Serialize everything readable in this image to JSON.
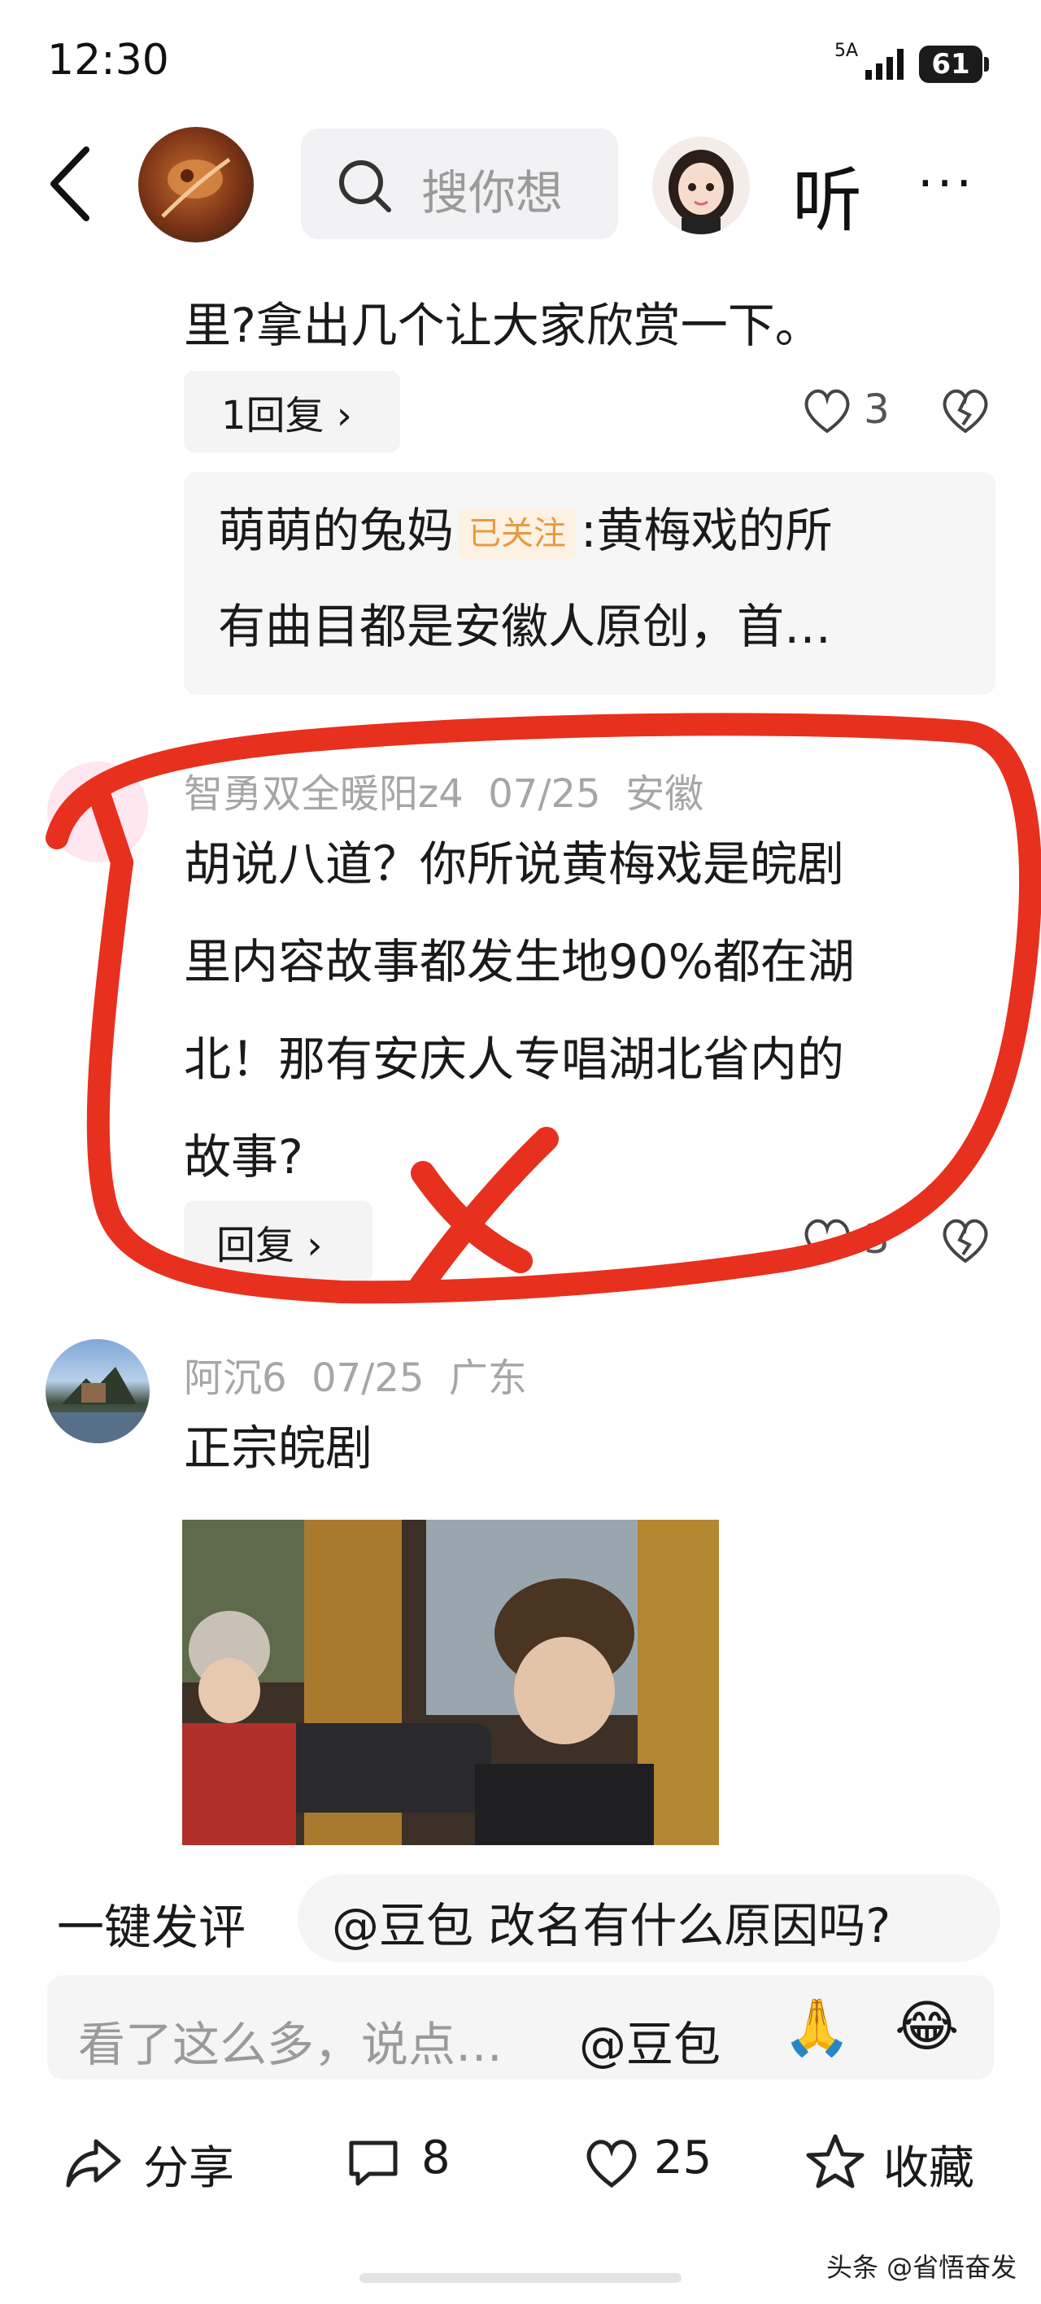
{
  "status_bar": {
    "time": "12:30",
    "network": "5A",
    "battery": "61"
  },
  "header": {
    "search_placeholder": "搜你想",
    "listen_label": "听",
    "more_label": "···"
  },
  "comment1": {
    "text_tail": "里?拿出几个让大家欣赏一下。",
    "reply_label": "1回复 ›",
    "like_count": "3",
    "quote": {
      "author": "萌萌的兔妈",
      "badge": "已关注",
      "line1_rest": ":黄梅戏的所",
      "line2": "有曲目都是安徽人原创，首…"
    }
  },
  "comment2": {
    "author": "智勇双全暖阳z4",
    "date": "07/25",
    "location": "安徽",
    "lines": [
      "胡说八道？你所说黄梅戏是皖剧",
      "里内容故事都发生地90%都在湖",
      "北！那有安庆人专唱湖北省内的",
      "故事?"
    ],
    "reply_label": "回复 ›",
    "like_count": "3"
  },
  "comment3": {
    "author": "阿沉6",
    "date": "07/25",
    "location": "广东",
    "text": "正宗皖剧"
  },
  "quick_comment": {
    "label": "一键发评",
    "suggestion": "@豆包 改名有什么原因吗?"
  },
  "comment_input": {
    "placeholder": "看了这么多，说点…",
    "mention": "@豆包",
    "emoji1": "🙏",
    "emoji2": "😂"
  },
  "bottom_bar": {
    "share": "分享",
    "comments": "8",
    "likes": "25",
    "favorite": "收藏"
  },
  "watermark": "头条 @省悟奋发",
  "colors": {
    "annotation_red": "#e8301e",
    "badge_orange": "#e69a42"
  }
}
